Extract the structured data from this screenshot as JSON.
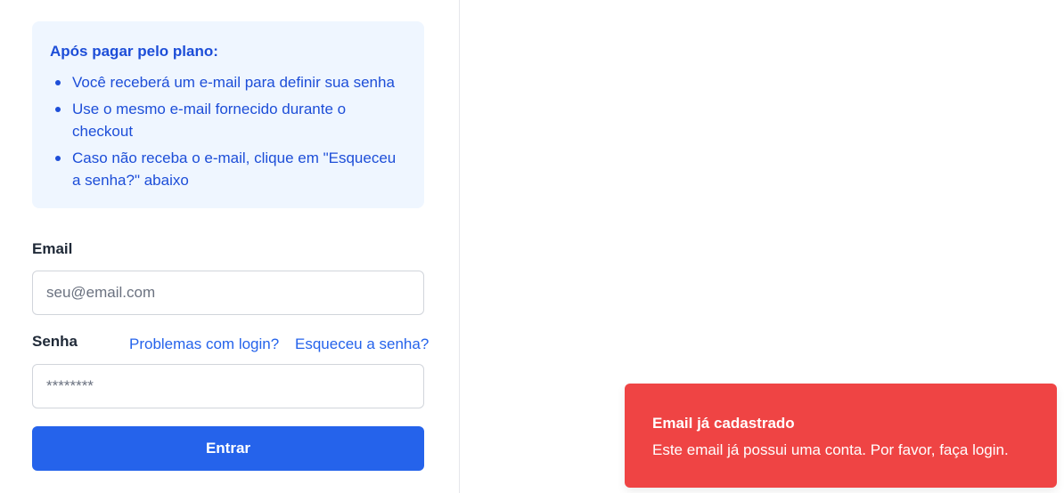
{
  "info": {
    "title": "Após pagar pelo plano:",
    "items": [
      "Você receberá um e-mail para definir sua senha",
      "Use o mesmo e-mail fornecido durante o checkout",
      "Caso não receba o e-mail, clique em \"Esqueceu a senha?\" abaixo"
    ]
  },
  "form": {
    "email_label": "Email",
    "email_placeholder": "seu@email.com",
    "password_label": "Senha",
    "login_problems_link": "Problemas com login?",
    "forgot_password_link": "Esqueceu a senha?",
    "password_placeholder": "********",
    "submit_label": "Entrar"
  },
  "toast": {
    "title": "Email já cadastrado",
    "message": "Este email já possui uma conta. Por favor, faça login.",
    "color": "#ef4444"
  },
  "colors": {
    "primary": "#2563eb",
    "info_bg": "#eff6ff",
    "info_text": "#1d4ed8"
  }
}
